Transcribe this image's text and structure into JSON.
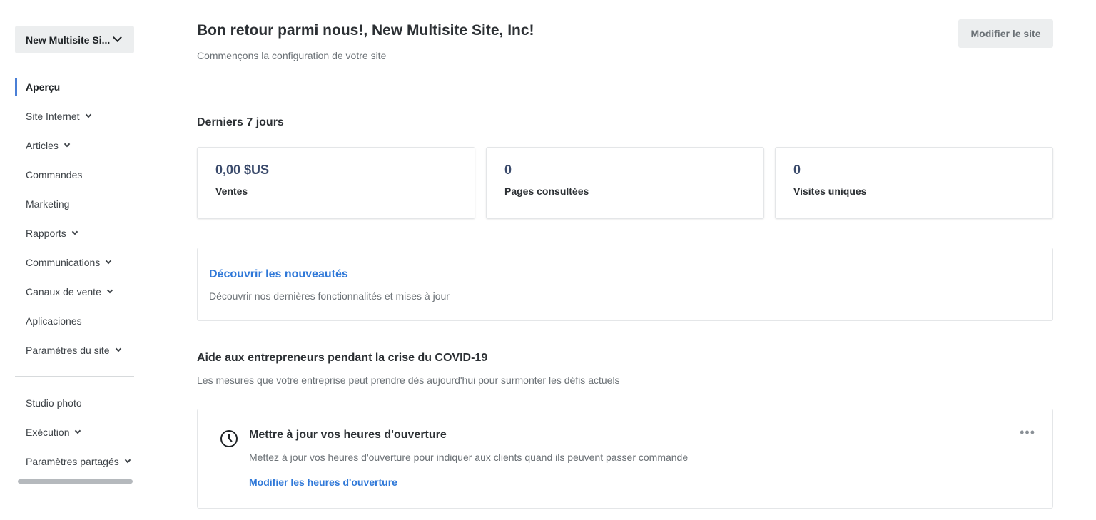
{
  "sidebar": {
    "site_name": "New Multisite Si...",
    "items": [
      {
        "label": "Aperçu",
        "active": true,
        "expandable": false
      },
      {
        "label": "Site Internet",
        "expandable": true
      },
      {
        "label": "Articles",
        "expandable": true
      },
      {
        "label": "Commandes",
        "expandable": false
      },
      {
        "label": "Marketing",
        "expandable": false
      },
      {
        "label": "Rapports",
        "expandable": true
      },
      {
        "label": "Communications",
        "expandable": true
      },
      {
        "label": "Canaux de vente",
        "expandable": true
      },
      {
        "label": "Aplicaciones",
        "expandable": false
      },
      {
        "label": "Paramètres du site",
        "expandable": true
      }
    ],
    "secondary_items": [
      {
        "label": "Studio photo",
        "expandable": false
      },
      {
        "label": "Exécution",
        "expandable": true
      },
      {
        "label": "Paramètres partagés",
        "expandable": true
      }
    ]
  },
  "header": {
    "title": "Bon retour parmi nous!, New Multisite Site, Inc!",
    "subtitle": "Commençons la configuration de votre site",
    "edit_site_label": "Modifier le site"
  },
  "stats": {
    "section_title": "Derniers 7 jours",
    "cards": [
      {
        "value": "0,00 $US",
        "label": "Ventes"
      },
      {
        "value": "0",
        "label": "Pages consultées"
      },
      {
        "value": "0",
        "label": "Visites uniques"
      }
    ]
  },
  "discover": {
    "link": "Découvrir les nouveautés",
    "description": "Découvrir nos dernières fonctionnalités et mises à jour"
  },
  "covid": {
    "title": "Aide aux entrepreneurs pendant la crise du COVID-19",
    "subtitle": "Les mesures que votre entreprise peut prendre dès aujourd'hui pour surmonter les défis actuels",
    "task": {
      "icon": "clock-icon",
      "title": "Mettre à jour vos heures d'ouverture",
      "description": "Mettez à jour vos heures d'ouverture pour indiquer aux clients quand ils peuvent passer commande",
      "action": "Modifier les heures d'ouverture",
      "more": "•••"
    }
  },
  "colors": {
    "accent": "#2f78d8",
    "active_indicator": "#4a7fd6"
  }
}
